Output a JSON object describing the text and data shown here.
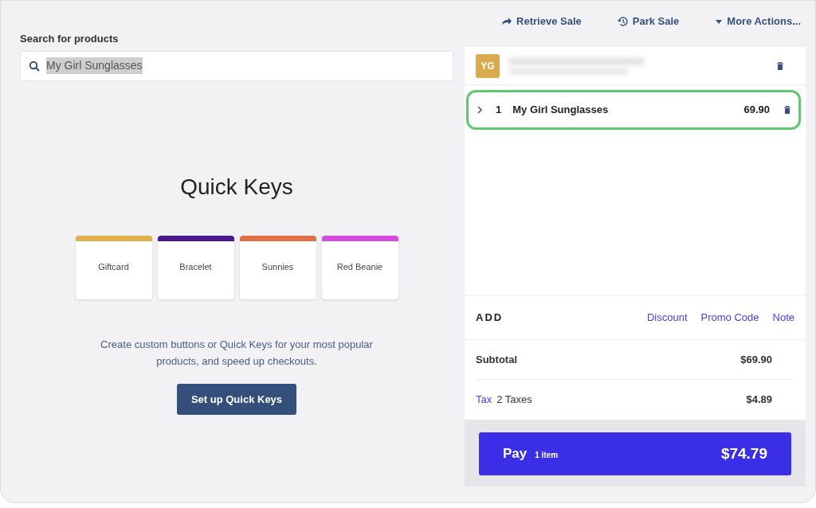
{
  "header_actions": [
    {
      "kind": "retrieve",
      "label": "Retrieve Sale"
    },
    {
      "kind": "park",
      "label": "Park Sale"
    },
    {
      "kind": "more",
      "label": "More Actions..."
    }
  ],
  "search": {
    "label": "Search for products",
    "value": "My Girl Sunglasses",
    "text_selected": true
  },
  "quick_keys": {
    "title": "Quick Keys",
    "keys": [
      {
        "label": "Giftcard",
        "color": "#e0b04a"
      },
      {
        "label": "Bracelet",
        "color": "#4a1a8c"
      },
      {
        "label": "Sunnies",
        "color": "#e07048"
      },
      {
        "label": "Red Beanie",
        "color": "#d24ae0"
      }
    ],
    "description": "Create custom buttons or Quick Keys for your most popular products, and speed up checkouts.",
    "button": "Set up Quick Keys"
  },
  "sale": {
    "customer": {
      "initials": "YG"
    },
    "line_items": [
      {
        "quantity": "1",
        "name": "My Girl Sunglasses",
        "price": "69.90",
        "highlighted": true
      }
    ],
    "add": {
      "label": "ADD",
      "actions": [
        "Discount",
        "Promo Code",
        "Note"
      ]
    },
    "subtotal": {
      "label": "Subtotal",
      "amount": "$69.90"
    },
    "tax": {
      "label": "Tax",
      "detail": "2 Taxes",
      "amount": "$4.89"
    },
    "pay": {
      "label": "Pay",
      "count": "1 item",
      "total": "$74.79"
    }
  }
}
